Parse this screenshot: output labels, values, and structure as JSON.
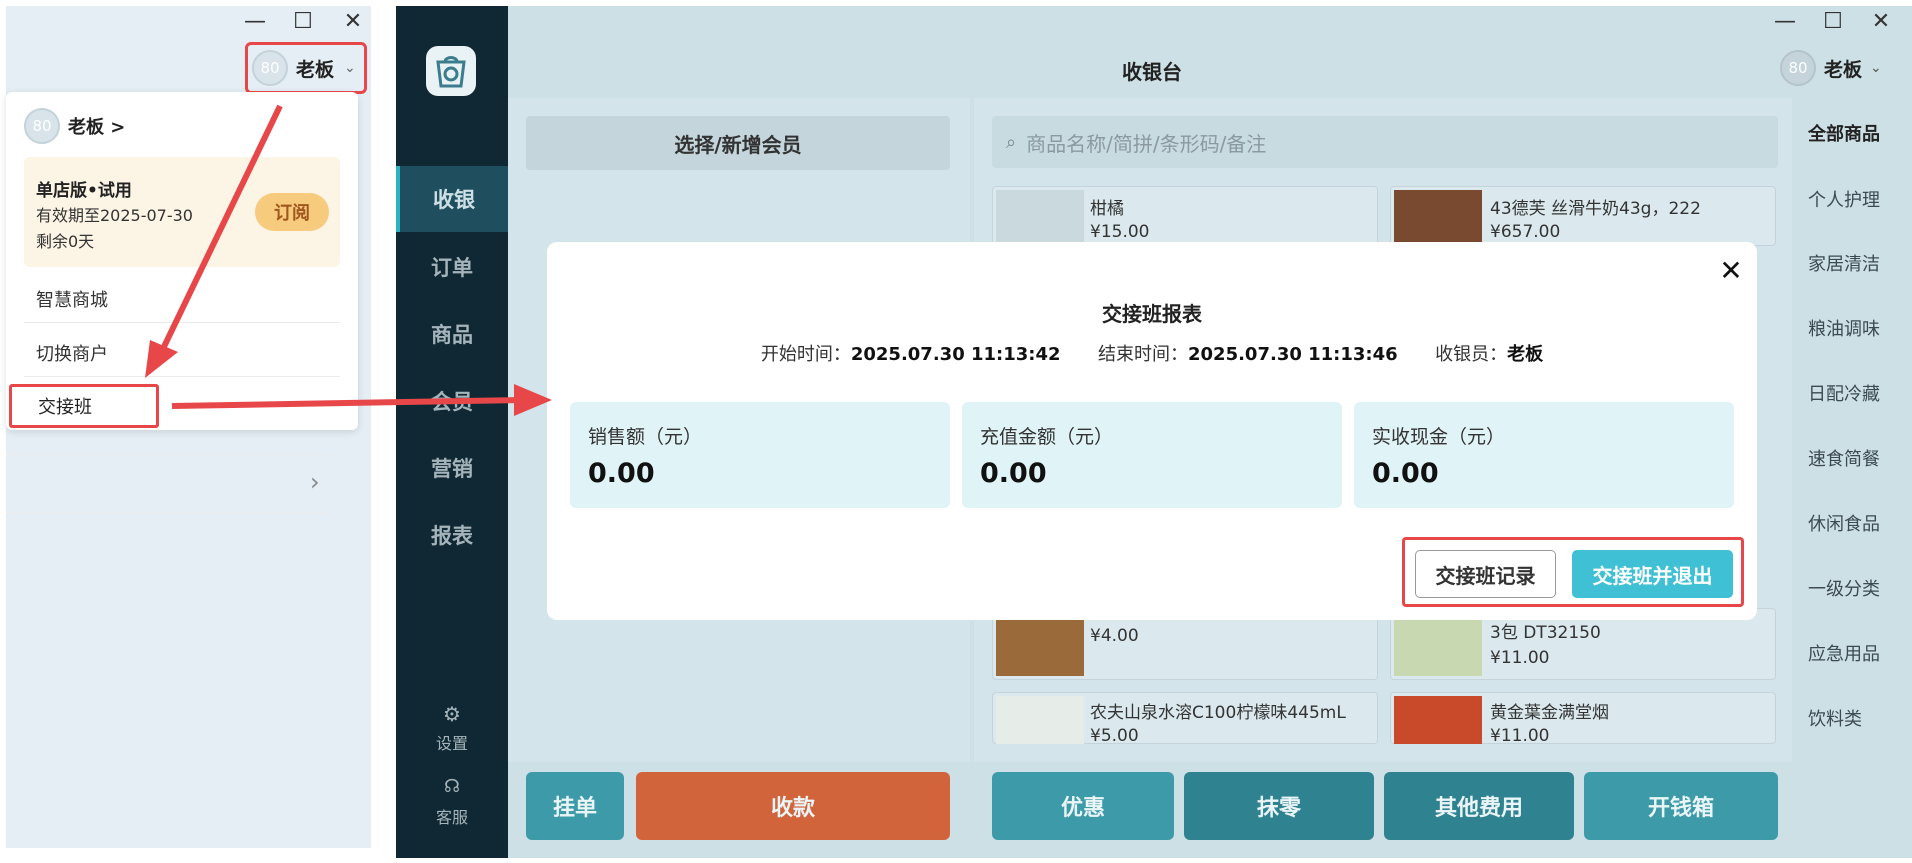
{
  "left_window": {
    "window_controls": {
      "minimize": "—",
      "maximize": "☐",
      "close": "✕"
    },
    "user": {
      "avatar_text": "80",
      "name": "老板"
    },
    "dropdown": {
      "head_avatar_text": "80",
      "head_name": "老板 >",
      "trial": {
        "title": "单店版•试用",
        "valid_until": "有效期至2025-07-30",
        "remaining": "剩余0天",
        "subscribe_label": "订阅"
      },
      "items": [
        "智慧商城",
        "切换商户",
        "交接班"
      ],
      "list_chevron": "›"
    }
  },
  "app": {
    "window_controls": {
      "minimize": "—",
      "maximize": "☐",
      "close": "✕"
    },
    "title": "收银台",
    "user": {
      "avatar_text": "80",
      "name": "老板"
    },
    "sidebar": {
      "items": [
        "收银",
        "订单",
        "商品",
        "会员",
        "营销",
        "报表"
      ],
      "active": "收银",
      "settings_label": "设置",
      "service_label": "客服"
    },
    "member_button": "选择/新增会员",
    "search_placeholder": "商品名称/简拼/条形码/备注",
    "products": [
      {
        "name": "柑橘",
        "price": "¥15.00"
      },
      {
        "name": "43德芙 丝滑牛奶43g，222",
        "price": "¥657.00"
      },
      {
        "name": "",
        "price": "¥4.00"
      },
      {
        "name": "3包 DT32150",
        "price": "¥11.00"
      },
      {
        "name": "农夫山泉水溶C100柠檬味445mL",
        "price": "¥5.00"
      },
      {
        "name": "黄金葉金满堂烟",
        "price": "¥11.00"
      }
    ],
    "categories": [
      "全部商品",
      "个人护理",
      "家居清洁",
      "粮油调味",
      "日配冷藏",
      "速食简餐",
      "休闲食品",
      "一级分类",
      "应急用品",
      "饮料类"
    ],
    "bottom_buttons": {
      "hold": "挂单",
      "checkout": "收款",
      "discount": "优惠",
      "round": "抹零",
      "other_fees": "其他费用",
      "open_drawer": "开钱箱"
    }
  },
  "dialog": {
    "title": "交接班报表",
    "start_label": "开始时间：",
    "start_value": "2025.07.30 11:13:42",
    "end_label": "结束时间：",
    "end_value": "2025.07.30 11:13:46",
    "cashier_label": "收银员：",
    "cashier_value": "老板",
    "stats": [
      {
        "label": "销售额（元）",
        "value": "0.00"
      },
      {
        "label": "充值金额（元）",
        "value": "0.00"
      },
      {
        "label": "实收现金（元）",
        "value": "0.00"
      }
    ],
    "records_button": "交接班记录",
    "handover_exit_button": "交接班并退出",
    "close_icon": "✕"
  },
  "colors": {
    "annotation_red": "#e8474a",
    "sidebar_dark": "#102833",
    "primary_button": "#3fc0d4",
    "checkout_orange": "#e0602a",
    "teal_button": "#2b8f9e"
  }
}
